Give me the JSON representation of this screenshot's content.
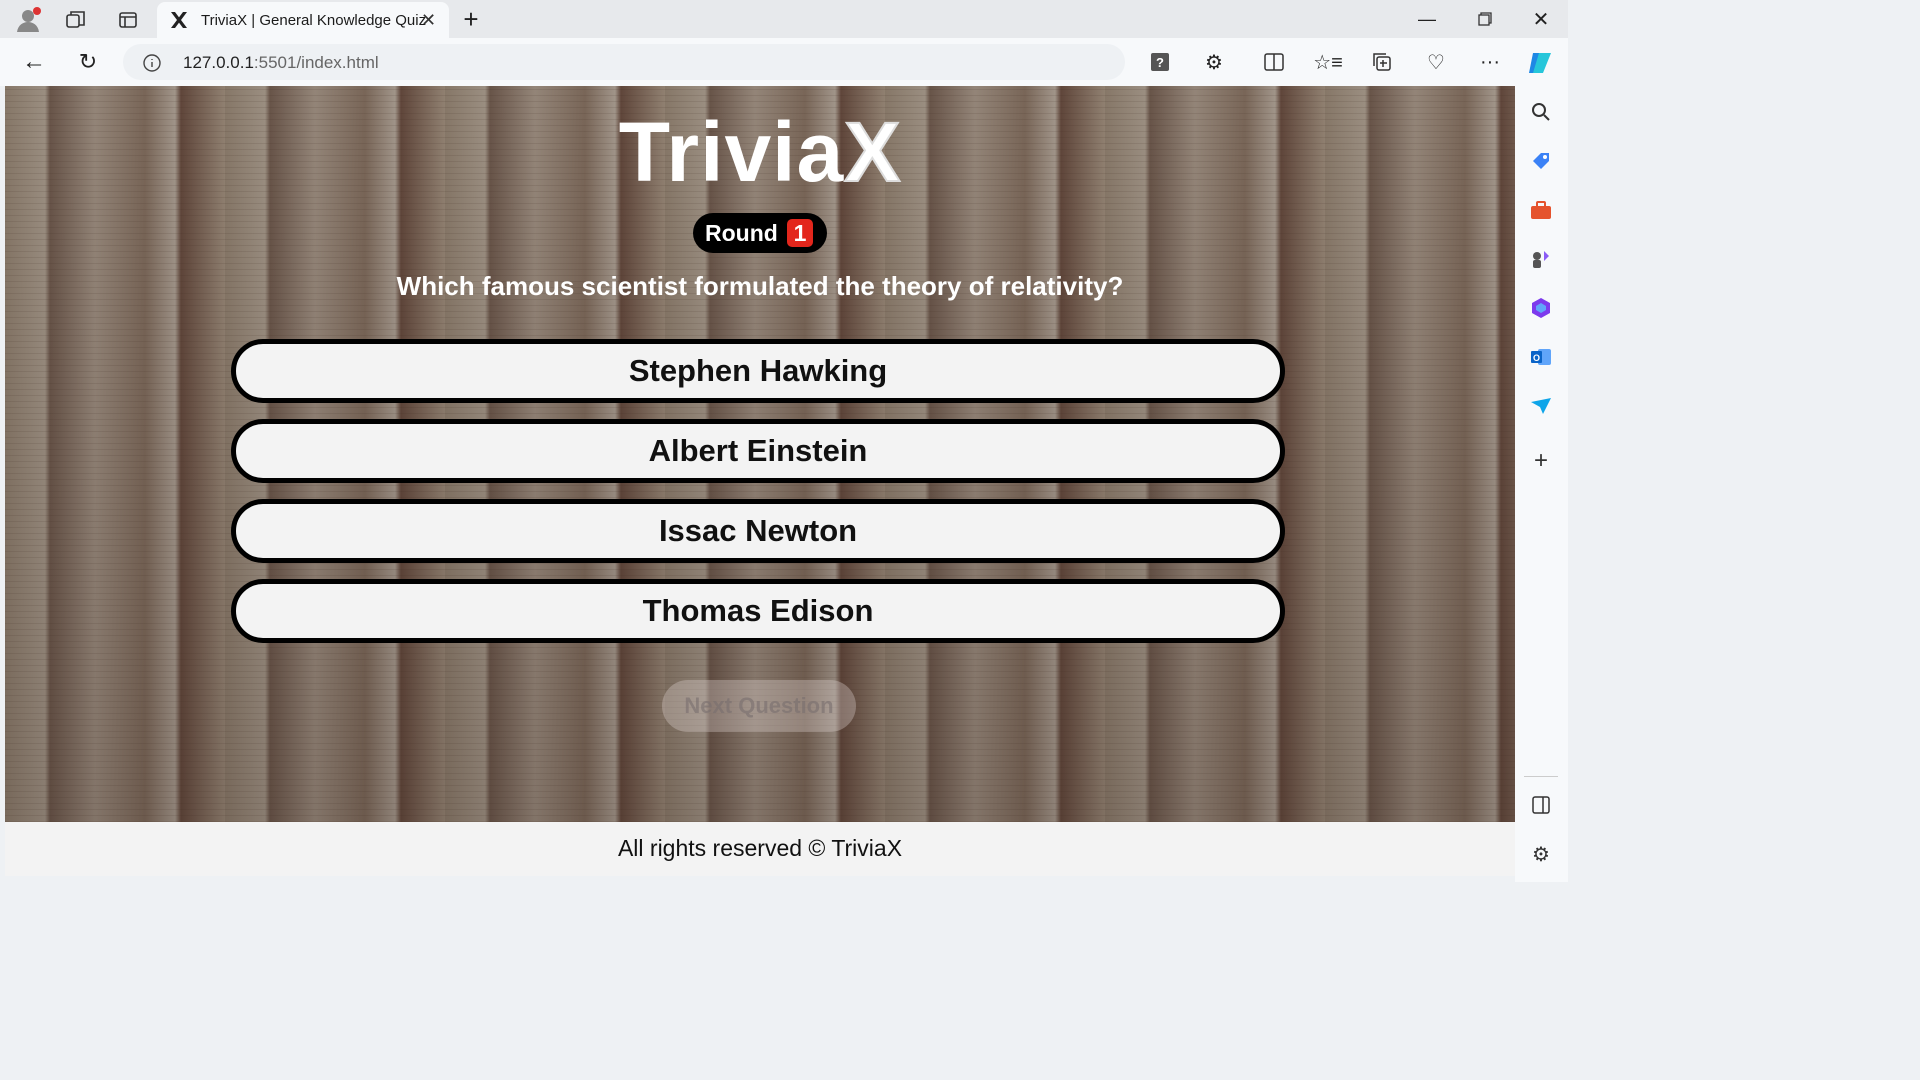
{
  "browser": {
    "tab_title": "TriviaX | General Knowledge Quiz",
    "url_host": "127.0.0.1",
    "url_rest": ":5501/index.html"
  },
  "app": {
    "logo_main": "Trivia",
    "logo_x": "X",
    "round_label": "Round",
    "round_number": "1",
    "question": "Which famous scientist formulated the theory of relativity?",
    "answers": [
      "Stephen Hawking",
      "Albert Einstein",
      "Issac Newton",
      "Thomas Edison"
    ],
    "next_button": "Next Question",
    "footer": "All rights reserved © TriviaX"
  },
  "colors": {
    "round_badge": "#e3261c",
    "answer_bg": "#f3f3f3",
    "answer_border": "#000000"
  }
}
